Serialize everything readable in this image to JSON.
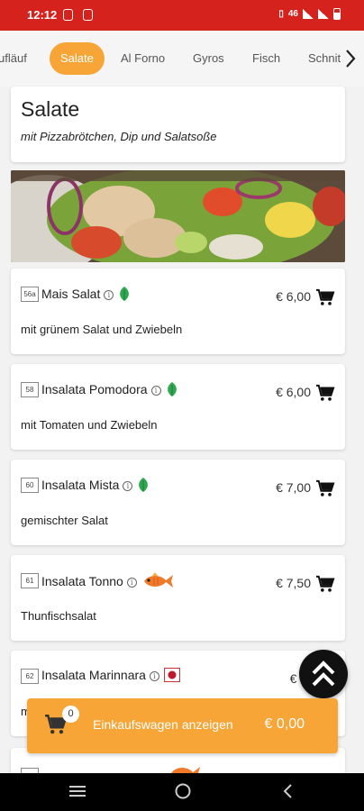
{
  "status": {
    "time": "12:12",
    "network": "46"
  },
  "tabs": [
    {
      "label": "ufläuf",
      "active": false
    },
    {
      "label": "Salate",
      "active": true
    },
    {
      "label": "Al Forno",
      "active": false
    },
    {
      "label": "Gyros",
      "active": false
    },
    {
      "label": "Fisch",
      "active": false
    },
    {
      "label": "Schnit",
      "active": false
    }
  ],
  "category": {
    "title": "Salate",
    "subtitle": "mit Pizzabrötchen, Dip und Salatsoße"
  },
  "items": [
    {
      "number": "56a",
      "name": "Mais Salat",
      "description": "mit grünem Salat und Zwiebeln",
      "price": "€ 6,00",
      "badge": "leaf-icon"
    },
    {
      "number": "58",
      "name": "Insalata Pomodora",
      "description": "mit Tomaten und Zwiebeln",
      "price": "€ 6,00",
      "badge": "leaf-icon"
    },
    {
      "number": "60",
      "name": "Insalata Mista",
      "description": "gemischter Salat",
      "price": "€ 7,00",
      "badge": "leaf-icon"
    },
    {
      "number": "61",
      "name": "Insalata Tonno",
      "description": "Thunfischsalat",
      "price": "€ 7,50",
      "badge": "fish-icon"
    },
    {
      "number": "62",
      "name": "Insalata Marinnara",
      "description": "m",
      "price": "€ 8,",
      "badge": "chili-icon"
    }
  ],
  "cart": {
    "count": "0",
    "label": "Einkaufswagen anzeigen",
    "total": "€ 0,00"
  },
  "colors": {
    "accent": "#f6a536",
    "statusbar": "#d6221d",
    "leaf": "#2fa84f"
  }
}
